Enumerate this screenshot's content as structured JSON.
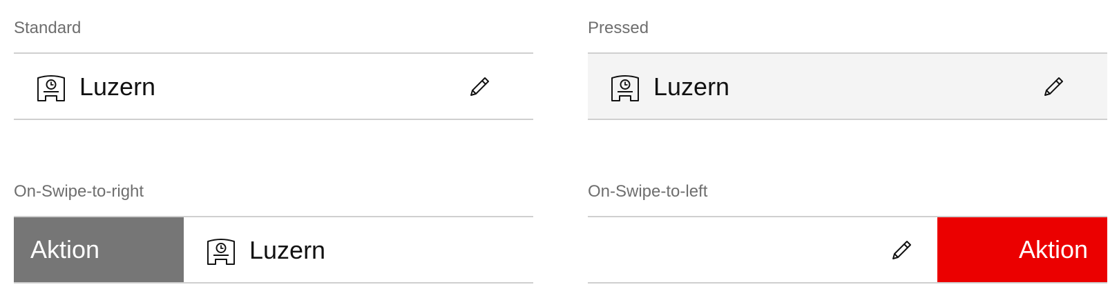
{
  "colors": {
    "divider": "#cfcfcf",
    "label": "#6e6e6e",
    "text": "#111111",
    "pressed_bg": "#f4f4f4",
    "action_neutral": "#767676",
    "action_destructive": "#eb0000"
  },
  "icons": {
    "station": "station-clock-icon",
    "edit": "pencil-icon"
  },
  "standard": {
    "label": "Standard",
    "station": "Luzern"
  },
  "pressed": {
    "label": "Pressed",
    "station": "Luzern"
  },
  "swipe_right": {
    "label": "On-Swipe-to-right",
    "action": "Aktion",
    "station": "Luzern"
  },
  "swipe_left": {
    "label": "On-Swipe-to-left",
    "action": "Aktion"
  }
}
